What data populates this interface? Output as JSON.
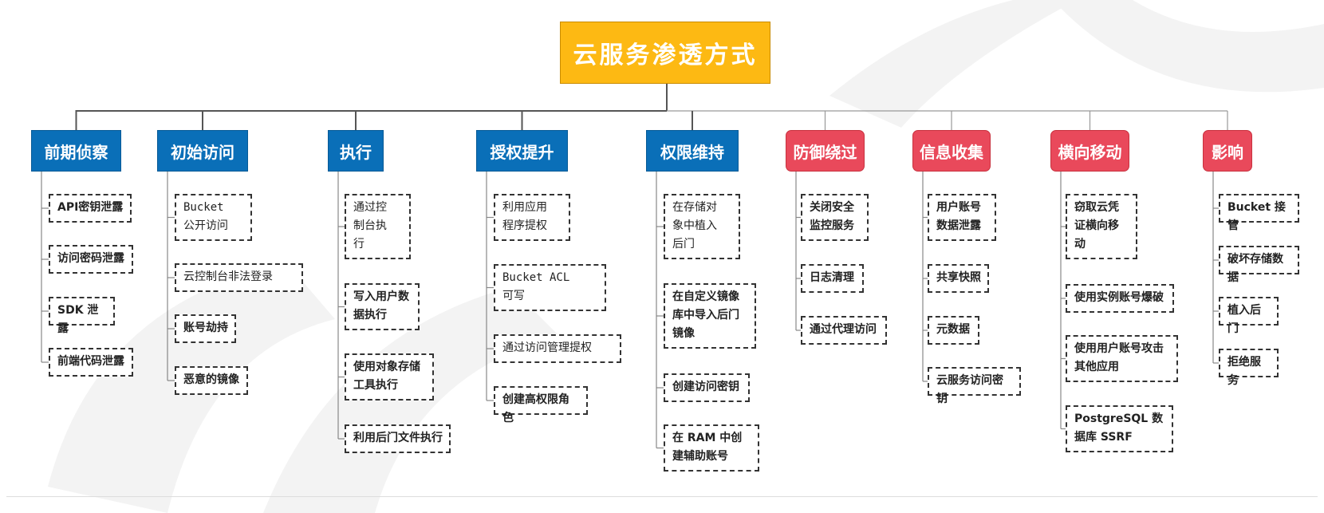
{
  "title": "云服务渗透方式",
  "colors": {
    "root": "#FDB913",
    "blue": "#0A6FB8",
    "red": "#E9495B",
    "connector": "#777777",
    "watermark": "#F3F3F3"
  },
  "categories": [
    {
      "label": "前期侦察",
      "color": "blue",
      "items": [
        {
          "text": "API密钥泄露",
          "bold": true
        },
        {
          "text": "访问密码泄露",
          "bold": true
        },
        {
          "text": "SDK 泄露",
          "bold": true
        },
        {
          "text": "前端代码泄露",
          "bold": true
        }
      ]
    },
    {
      "label": "初始访问",
      "color": "blue",
      "items": [
        {
          "text": "Bucket\n公开访问",
          "mono": true
        },
        {
          "text": "云控制台非法登录",
          "mono": true
        },
        {
          "text": "账号劫持",
          "bold": true
        },
        {
          "text": "恶意的镜像",
          "bold": true
        }
      ]
    },
    {
      "label": "执行",
      "color": "blue",
      "items": [
        {
          "text": "通过控\n制台执\n行",
          "mono": true
        },
        {
          "text": "写入用户数\n据执行",
          "bold": true
        },
        {
          "text": "使用对象存储\n工具执行",
          "bold": true
        },
        {
          "text": "利用后门文件执行",
          "bold": true
        }
      ]
    },
    {
      "label": "授权提升",
      "color": "blue",
      "items": [
        {
          "text": "利用应用\n程序提权",
          "mono": true
        },
        {
          "text": "Bucket ACL\n可写",
          "mono": true
        },
        {
          "text": "通过访问管理提权",
          "mono": true
        },
        {
          "text": "创建高权限角色",
          "bold": true
        }
      ]
    },
    {
      "label": "权限维持",
      "color": "blue",
      "items": [
        {
          "text": "在存储对\n象中植入\n后门",
          "mono": true
        },
        {
          "text": "在自定义镜像\n库中导入后门\n镜像",
          "bold": true
        },
        {
          "text": "创建访问密钥",
          "bold": true
        },
        {
          "text": "在 RAM 中创\n建辅助账号",
          "bold": true
        }
      ]
    },
    {
      "label": "防御绕过",
      "color": "red",
      "items": [
        {
          "text": "关闭安全\n监控服务",
          "bold": true
        },
        {
          "text": "日志清理",
          "bold": true
        },
        {
          "text": "通过代理访问",
          "bold": true
        }
      ]
    },
    {
      "label": "信息收集",
      "color": "red",
      "items": [
        {
          "text": "用户账号\n数据泄露",
          "bold": true
        },
        {
          "text": "共享快照",
          "bold": true
        },
        {
          "text": "元数据",
          "bold": true
        },
        {
          "text": "云服务访问密钥",
          "bold": true
        }
      ]
    },
    {
      "label": "横向移动",
      "color": "red",
      "items": [
        {
          "text": "窃取云凭\n证横向移\n动",
          "bold": true
        },
        {
          "text": "使用实例账号爆破",
          "bold": true
        },
        {
          "text": "使用用户账号攻击\n其他应用",
          "bold": true
        },
        {
          "text": "PostgreSQL 数\n据库 SSRF",
          "bold": true
        }
      ]
    },
    {
      "label": "影响",
      "color": "red",
      "items": [
        {
          "text": "Bucket 接管",
          "bold": true
        },
        {
          "text": "破坏存储数据",
          "bold": true
        },
        {
          "text": "植入后门",
          "bold": true
        },
        {
          "text": "拒绝服务",
          "bold": true
        }
      ]
    }
  ]
}
